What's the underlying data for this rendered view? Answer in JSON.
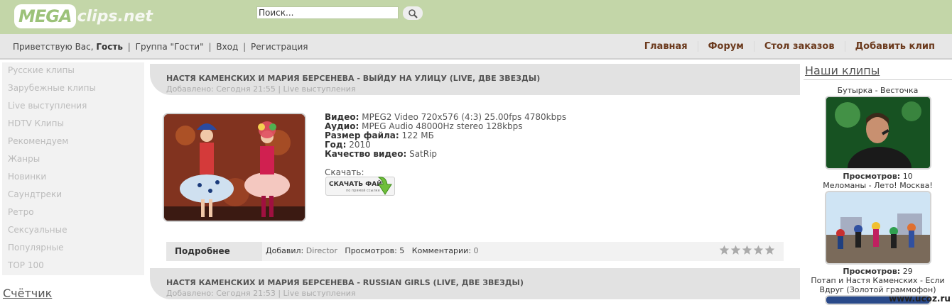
{
  "logo": {
    "mega": "MEGA",
    "rest": "clips.net"
  },
  "search": {
    "placeholder": "Поиск...",
    "value": "Поиск..."
  },
  "greeting": {
    "prefix": "Приветствую Вас,",
    "user": "Гость",
    "group_prefix": "Группа \"",
    "group": "Гости",
    "group_suffix": "\"",
    "login": "Вход",
    "register": "Регистрация"
  },
  "topmenu": [
    "Главная",
    "Форум",
    "Стол заказов",
    "Добавить клип"
  ],
  "sidebar": {
    "items": [
      "Русские клипы",
      "Зарубежные клипы",
      "Live выступления",
      "HDTV Клипы",
      "Рекомендуем",
      "Жанры",
      "Новинки",
      "Саундтреки",
      "Ретро",
      "Сексуальные",
      "Популярные",
      "TOP 100"
    ],
    "counter_title": "Счётчик"
  },
  "posts": [
    {
      "title": "НАСТЯ КАМЕНСКИХ И МАРИЯ БЕРСЕНЕВА - ВЫЙДУ НА УЛИЦУ (LIVE, ДВЕ ЗВЕЗДЫ)",
      "meta": "Добавлено: Сегодня 21:55 | Live выступления",
      "video_label": "Видео:",
      "video": "MPEG2 Video 720x576 (4:3) 25.00fps 4780kbps",
      "audio_label": "Аудио:",
      "audio": "MPEG Audio 48000Hz stereo 128kbps",
      "size_label": "Размер файла:",
      "size": "122 МБ",
      "year_label": "Год:",
      "year": "2010",
      "quality_label": "Качество видео:",
      "quality": "SatRip",
      "download_label": "Скачать:",
      "download_btn": "СКАЧАТЬ ФАЙЛ",
      "download_sub": "по прямой ссылке",
      "more": "Подробнее",
      "added_by_label": "Добавил:",
      "added_by": "Director",
      "views_label": "Просмотров:",
      "views": "5",
      "comments_label": "Комментарии:",
      "comments": "0",
      "rating_stars": 5
    },
    {
      "title": "НАСТЯ КАМЕНСКИХ И МАРИЯ БЕРСЕНЕВА - RUSSIAN GIRLS (LIVE, ДВЕ ЗВЕЗДЫ)",
      "meta": "Добавлено: Сегодня 21:53 | Live выступления"
    }
  ],
  "right": {
    "title": "Наши клипы",
    "clips": [
      {
        "title": "Бутырка - Весточка",
        "views_label": "Просмотров:",
        "views": "10"
      },
      {
        "title": "Меломаны - Лето! Москва!",
        "views_label": "Просмотров:",
        "views": "29"
      },
      {
        "title": "Потап и Настя Каменских - Если Вдруг (Золотой граммофон)"
      }
    ]
  },
  "watermark": "www.ucoz.ru",
  "colors": {
    "header": "#c3d6a8",
    "menu": "#6b3a1d",
    "navbar": "#e7e7e7"
  }
}
